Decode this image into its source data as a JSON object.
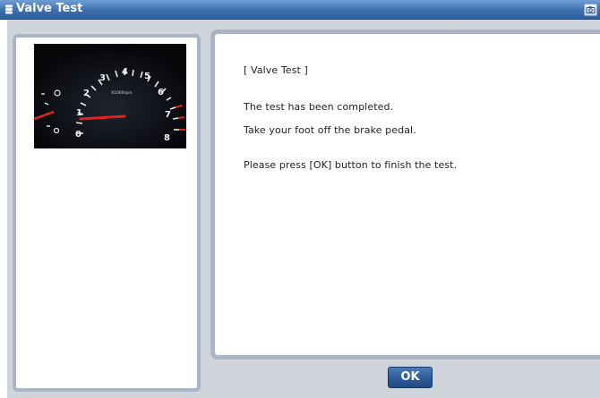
{
  "window": {
    "title": "Valve Test",
    "title_icon": "drive-icon",
    "window_button_icon": "camera-icon"
  },
  "image": {
    "description_icon": "tachometer-gauge-image",
    "dial_labels": [
      "0",
      "1",
      "2",
      "3",
      "4",
      "5",
      "6",
      "7",
      "8"
    ],
    "unit_label": "X1000rpm"
  },
  "message": {
    "heading": "[ Valve Test ]",
    "line1": "The test has been completed.",
    "line2": "Take your foot off the brake pedal.",
    "line3": "Please press [OK] button to finish the test."
  },
  "buttons": {
    "ok_label": "OK"
  },
  "colors": {
    "titlebar": "#3c6fb0",
    "panel_border": "#a9b4c6",
    "ok_button": "#2d5b97",
    "needle": "#e0261b"
  }
}
